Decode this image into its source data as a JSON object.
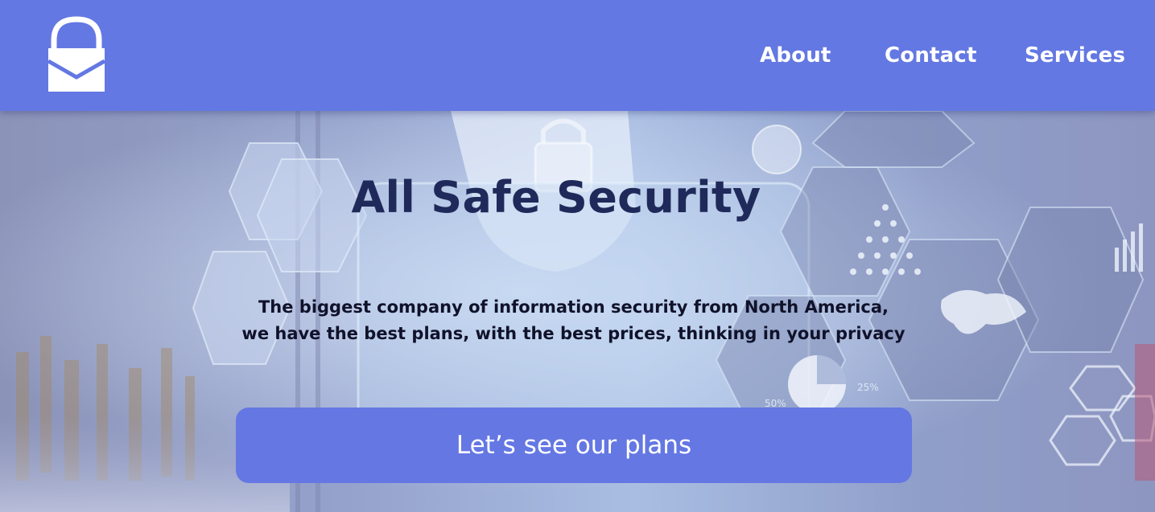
{
  "colors": {
    "header_bg": "#6378e2",
    "cta_bg": "#6477e3",
    "title_color": "#1f2a5a",
    "nav_text": "#ffffff"
  },
  "header": {
    "logo_icon": "lock-envelope-icon",
    "nav": {
      "about": "About",
      "contact": "Contact",
      "services": "Services"
    }
  },
  "hero": {
    "title": "All Safe Security",
    "subtitle_line1": "The biggest company of information security from North America,",
    "subtitle_line2": "we have the best plans, with the best prices, thinking in your privacy",
    "cta_label": "Let’s see our plans",
    "background_image": "cybersecurity-hexagon-collage",
    "background_labels": {
      "pie_left": "50%",
      "pie_right": "25%"
    }
  }
}
